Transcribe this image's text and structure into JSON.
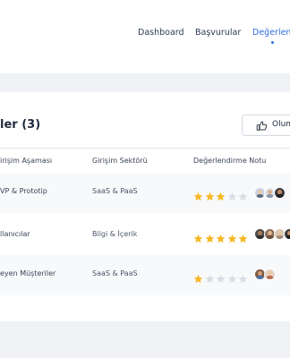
{
  "nav": {
    "items": [
      {
        "label": "Dashboard"
      },
      {
        "label": "Başvurular"
      },
      {
        "label": "Değerlend"
      }
    ]
  },
  "card": {
    "title": "ler (3)",
    "eval_button_label": "Olum"
  },
  "table": {
    "columns": [
      "irişim Aşaması",
      "Girişim Sektörü",
      "Değerlendirme Notu"
    ],
    "rows": [
      {
        "stage": "VP & Prototip",
        "sector": "SaaS & PaaS",
        "rating": 3
      },
      {
        "stage": "llanıcılar",
        "sector": "Bilgi & İçerik",
        "rating": 5
      },
      {
        "stage": "eyen Müşteriler",
        "sector": "SaaS & PaaS",
        "rating": 1
      }
    ]
  },
  "colors": {
    "accent": "#2f6fe0",
    "star_filled": "#f6b824",
    "star_empty": "#d9dde4"
  }
}
